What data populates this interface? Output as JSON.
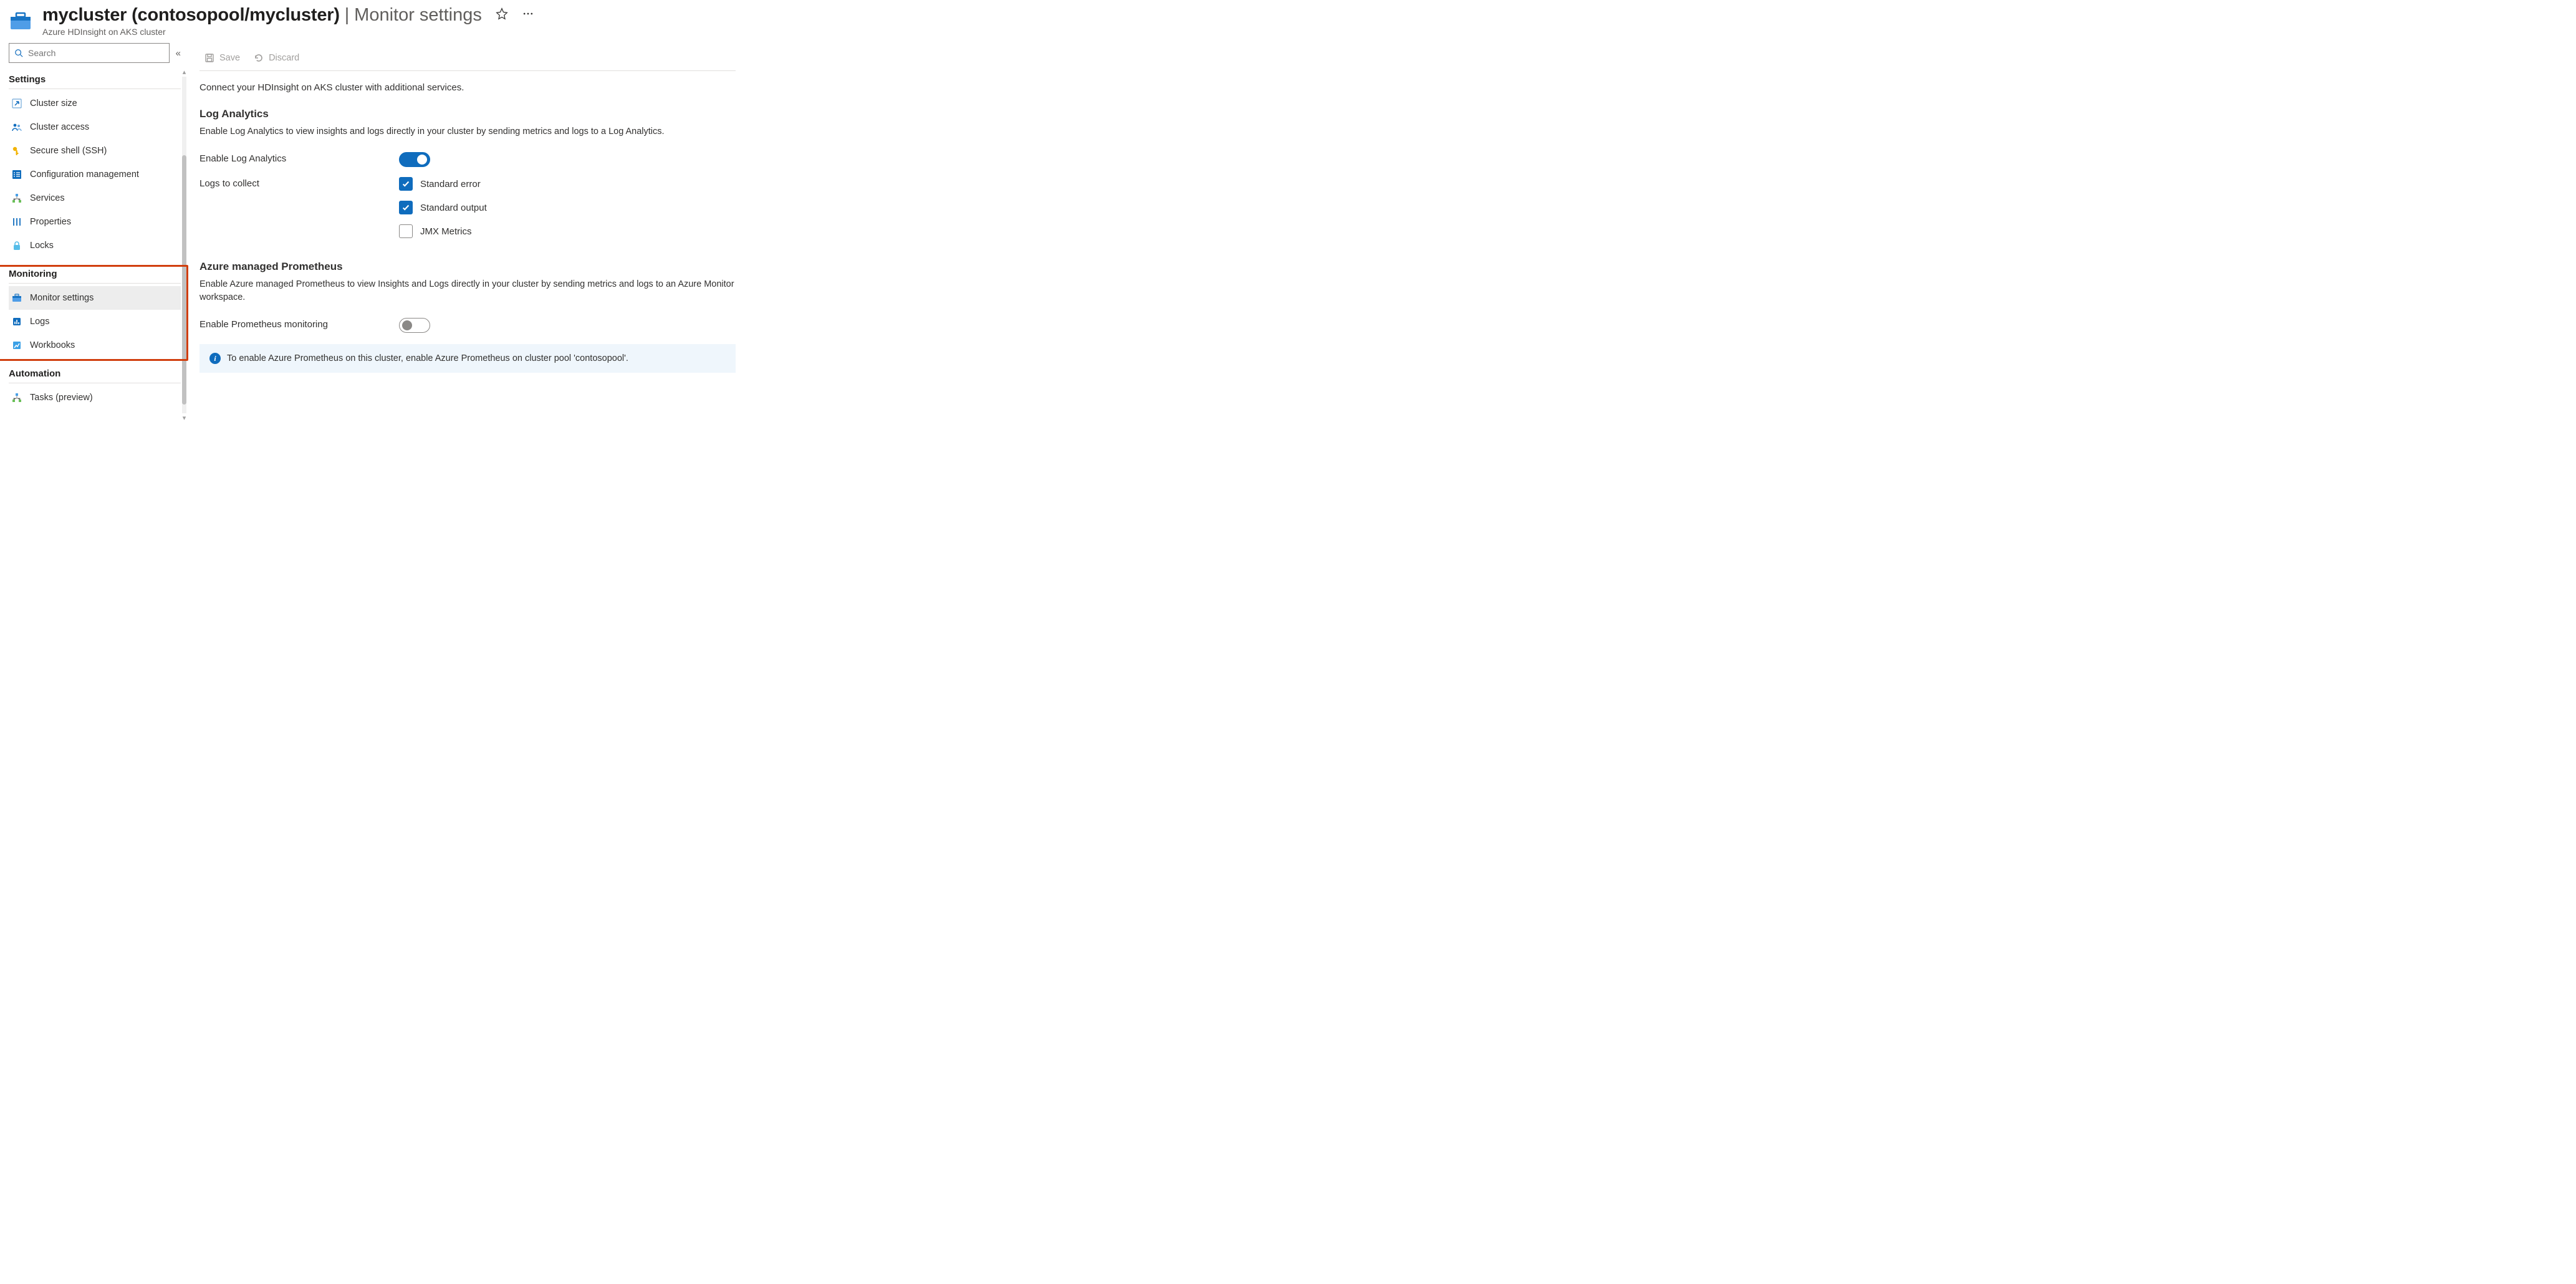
{
  "header": {
    "resource_name": "mycluster (contosopool/mycluster)",
    "page_title": "Monitor settings",
    "breadcrumb": "Azure HDInsight on AKS cluster"
  },
  "sidebar": {
    "search_placeholder": "Search",
    "sections": {
      "settings": {
        "label": "Settings",
        "items": [
          {
            "label": "Cluster size"
          },
          {
            "label": "Cluster access"
          },
          {
            "label": "Secure shell (SSH)"
          },
          {
            "label": "Configuration management"
          },
          {
            "label": "Services"
          },
          {
            "label": "Properties"
          },
          {
            "label": "Locks"
          }
        ]
      },
      "monitoring": {
        "label": "Monitoring",
        "items": [
          {
            "label": "Monitor settings"
          },
          {
            "label": "Logs"
          },
          {
            "label": "Workbooks"
          }
        ]
      },
      "automation": {
        "label": "Automation",
        "items": [
          {
            "label": "Tasks (preview)"
          }
        ]
      }
    }
  },
  "toolbar": {
    "save_label": "Save",
    "discard_label": "Discard"
  },
  "main": {
    "intro": "Connect your HDInsight on AKS cluster with additional services.",
    "log_analytics": {
      "title": "Log Analytics",
      "desc": "Enable Log Analytics to view insights and logs directly in your cluster by sending metrics and logs to a Log Analytics.",
      "enable_label": "Enable Log Analytics",
      "enable_value": true,
      "logs_label": "Logs to collect",
      "checks": [
        {
          "label": "Standard error",
          "checked": true
        },
        {
          "label": "Standard output",
          "checked": true
        },
        {
          "label": "JMX Metrics",
          "checked": false
        }
      ]
    },
    "prometheus": {
      "title": "Azure managed Prometheus",
      "desc": "Enable Azure managed Prometheus to view Insights and Logs directly in your cluster by sending metrics and logs to an Azure Monitor workspace.",
      "enable_label": "Enable Prometheus monitoring",
      "enable_value": false,
      "info": "To enable Azure Prometheus on this cluster, enable Azure Prometheus on cluster pool 'contosopool'."
    }
  }
}
